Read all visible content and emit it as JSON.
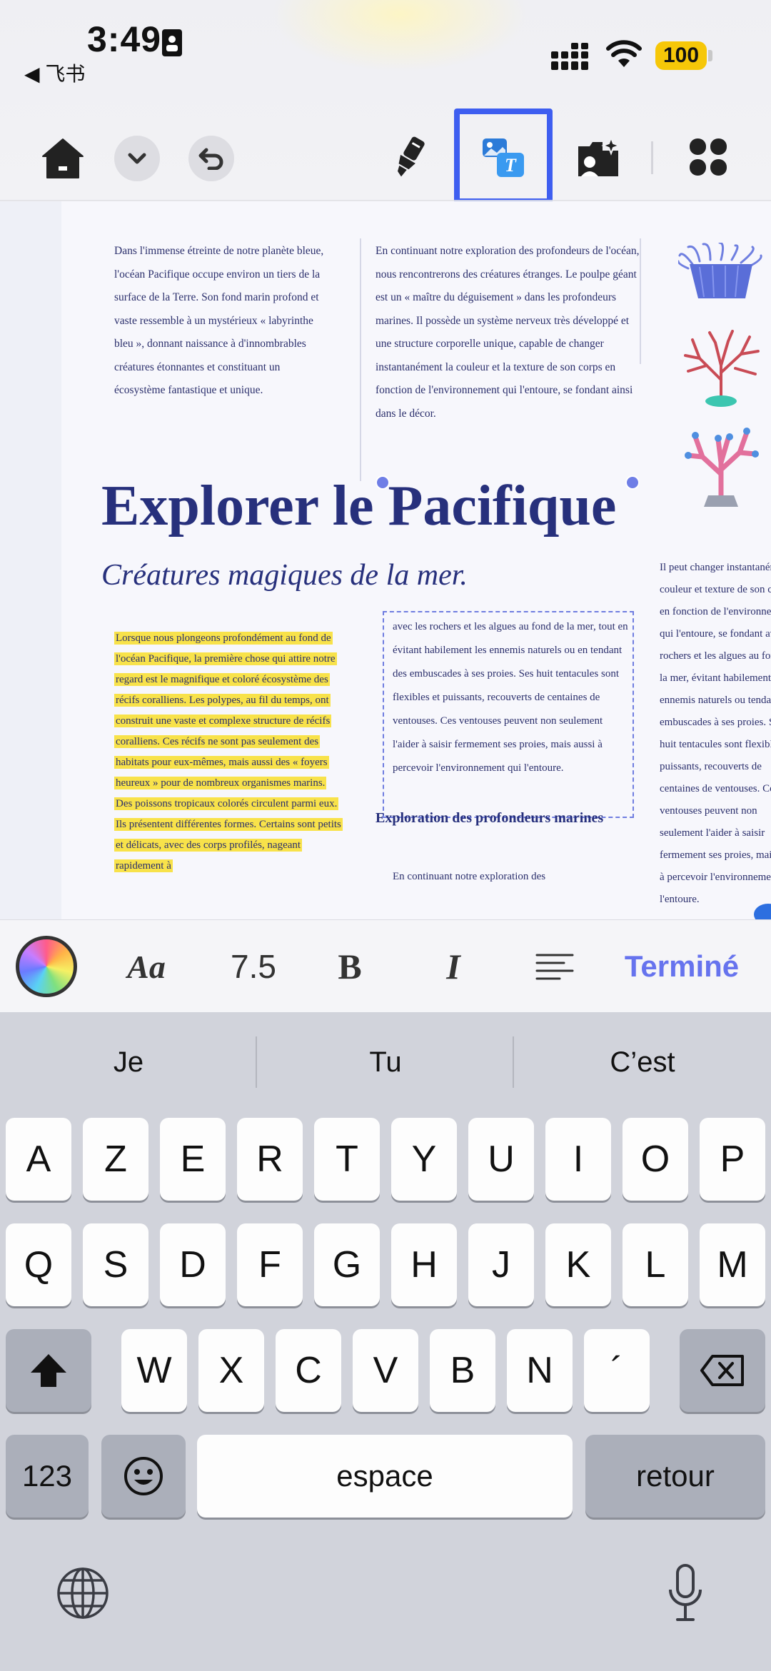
{
  "status": {
    "time": "3:49",
    "back_app": "◀ 飞书",
    "battery": "100"
  },
  "toolbar": {
    "icons": [
      "home-icon",
      "chevron-down-icon",
      "undo-icon",
      "highlighter-icon",
      "translate-icon",
      "ai-image-icon",
      "grid-icon"
    ],
    "selected": "translate-icon",
    "accent": "#3e5ef0"
  },
  "document": {
    "col1": "Dans l'immense étreinte de notre planète bleue, l'océan Pacifique occupe environ un tiers de la surface de la Terre. Son fond marin profond et vaste ressemble à un mystérieux « labyrinthe bleu », donnant naissance à d'innombrables créatures étonnantes et constituant un écosystème fantastique et unique.",
    "col2": "En continuant notre exploration des profondeurs de l'océan, nous rencontrerons des créatures étranges. Le poulpe géant est un « maître du déguisement » dans les profondeurs marines. Il possède un système nerveux très développé et une structure corporelle unique, capable de changer instantanément la couleur et la texture de son corps en fonction de l'environnement qui l'entoure, se fondant ainsi dans le décor.",
    "title": "Explorer le Pacifique",
    "subtitle": "Créatures magiques de la mer.",
    "highlighted": "Lorsque nous plongeons profondément au fond de l'océan Pacifique, la première chose qui attire notre regard est le magnifique et coloré écosystème des récifs coralliens. Les polypes, au fil du temps, ont construit une vaste et complexe structure de récifs coralliens. Ces récifs ne sont pas seulement des habitats pour eux-mêmes, mais aussi des « foyers heureux » pour de nombreux organismes marins. Des poissons tropicaux colorés circulent parmi eux. Ils présentent différentes formes. Certains sont petits et délicats, avec des corps profilés, nageant rapidement à",
    "editing": "avec les rochers et les algues au fond de la mer, tout en évitant habilement les ennemis naturels ou en tendant des embuscades à ses proies. Ses huit tentacules sont flexibles et puissants, recouverts de centaines de ventouses. Ces ventouses peuvent non seulement l'aider à saisir fermement ses proies, mais aussi à percevoir l'environnement qui l'entoure.",
    "heading": "Exploration des profondeurs marines",
    "col_bottom": "En continuant notre exploration des",
    "col_right": "Il peut changer instantanément la couleur et texture de son corps en fonction de l'environnement qui l'entoure, se fondant avec les rochers et les algues au fond de la mer, évitant habilement les ennemis naturels ou tendant des embuscades à ses proies. Ses huit tentacules sont flexibles et puissants, recouverts de centaines de ventouses. Ces ventouses peuvent non seulement l'aider à saisir fermement ses proies, mais aussi à percevoir l'environnement qui l'entoure."
  },
  "format_bar": {
    "font_icon": "Aa",
    "size": "7.5",
    "bold": "B",
    "italic": "I",
    "done": "Terminé"
  },
  "keyboard": {
    "suggestions": [
      "Je",
      "Tu",
      "C’est"
    ],
    "row1": [
      "A",
      "Z",
      "E",
      "R",
      "T",
      "Y",
      "U",
      "I",
      "O",
      "P"
    ],
    "row2": [
      "Q",
      "S",
      "D",
      "F",
      "G",
      "H",
      "J",
      "K",
      "L",
      "M"
    ],
    "row3": [
      "W",
      "X",
      "C",
      "V",
      "B",
      "N",
      "´"
    ],
    "numbers": "123",
    "space": "espace",
    "return": "retour"
  }
}
